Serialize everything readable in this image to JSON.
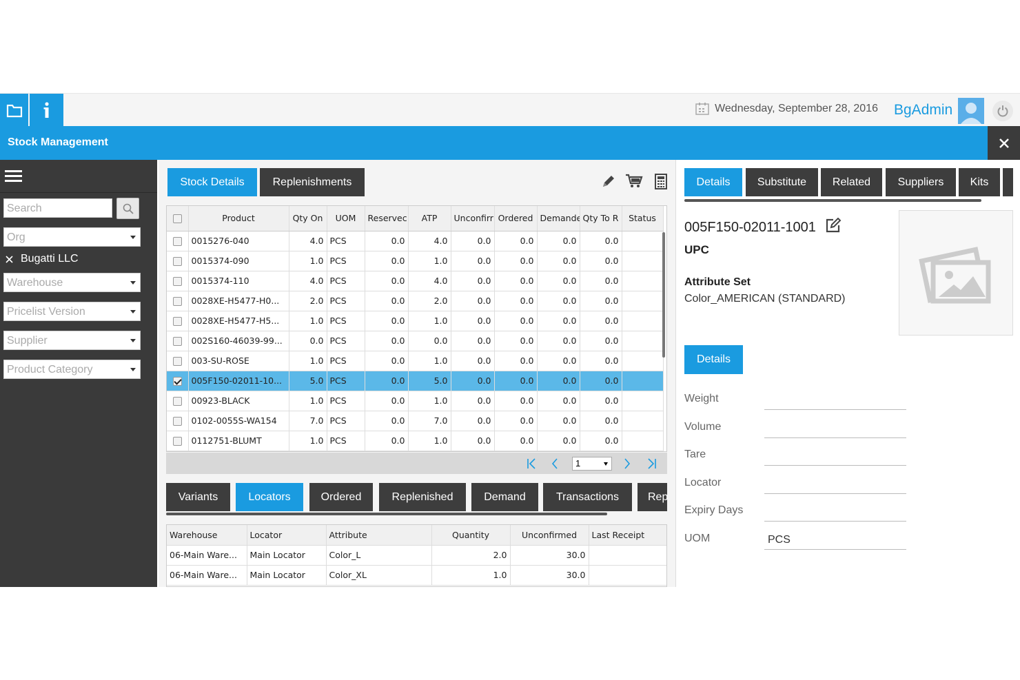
{
  "topbar": {
    "date": "Wednesday, September 28, 2016",
    "user": "BgAdmin"
  },
  "title": "Stock Management",
  "sidebar": {
    "search_placeholder": "Search",
    "org_placeholder": "Org",
    "org_selected": "Bugatti LLC",
    "warehouse_placeholder": "Warehouse",
    "pricelist_placeholder": "Pricelist Version",
    "supplier_placeholder": "Supplier",
    "category_placeholder": "Product Category"
  },
  "center_tabs": [
    "Stock Details",
    "Replenishments"
  ],
  "grid": {
    "columns": [
      "Product",
      "Qty On",
      "UOM",
      "Reservec",
      "ATP",
      "Unconfirr",
      "Ordered",
      "Demande",
      "Qty To R",
      "Status"
    ],
    "rows": [
      {
        "product": "0015276-040",
        "qty": "4.0",
        "uom": "PCS",
        "reserved": "0.0",
        "atp": "4.0",
        "unconfirmed": "0.0",
        "ordered": "0.0",
        "demand": "0.0",
        "qty_to_r": "0.0",
        "status": "",
        "checked": false
      },
      {
        "product": "0015374-090",
        "qty": "1.0",
        "uom": "PCS",
        "reserved": "0.0",
        "atp": "1.0",
        "unconfirmed": "0.0",
        "ordered": "0.0",
        "demand": "0.0",
        "qty_to_r": "0.0",
        "status": "",
        "checked": false
      },
      {
        "product": "0015374-110",
        "qty": "4.0",
        "uom": "PCS",
        "reserved": "0.0",
        "atp": "4.0",
        "unconfirmed": "0.0",
        "ordered": "0.0",
        "demand": "0.0",
        "qty_to_r": "0.0",
        "status": "",
        "checked": false
      },
      {
        "product": "0028XE-H5477-H0...",
        "qty": "2.0",
        "uom": "PCS",
        "reserved": "0.0",
        "atp": "2.0",
        "unconfirmed": "0.0",
        "ordered": "0.0",
        "demand": "0.0",
        "qty_to_r": "0.0",
        "status": "",
        "checked": false
      },
      {
        "product": "0028XE-H5477-H5...",
        "qty": "1.0",
        "uom": "PCS",
        "reserved": "0.0",
        "atp": "1.0",
        "unconfirmed": "0.0",
        "ordered": "0.0",
        "demand": "0.0",
        "qty_to_r": "0.0",
        "status": "",
        "checked": false
      },
      {
        "product": "002S160-46039-99...",
        "qty": "0.0",
        "uom": "PCS",
        "reserved": "0.0",
        "atp": "0.0",
        "unconfirmed": "0.0",
        "ordered": "0.0",
        "demand": "0.0",
        "qty_to_r": "0.0",
        "status": "",
        "checked": false
      },
      {
        "product": "003-SU-ROSE",
        "qty": "1.0",
        "uom": "PCS",
        "reserved": "0.0",
        "atp": "1.0",
        "unconfirmed": "0.0",
        "ordered": "0.0",
        "demand": "0.0",
        "qty_to_r": "0.0",
        "status": "",
        "checked": false
      },
      {
        "product": "005F150-02011-10...",
        "qty": "5.0",
        "uom": "PCS",
        "reserved": "0.0",
        "atp": "5.0",
        "unconfirmed": "0.0",
        "ordered": "0.0",
        "demand": "0.0",
        "qty_to_r": "0.0",
        "status": "",
        "checked": true
      },
      {
        "product": "00923-BLACK",
        "qty": "1.0",
        "uom": "PCS",
        "reserved": "0.0",
        "atp": "1.0",
        "unconfirmed": "0.0",
        "ordered": "0.0",
        "demand": "0.0",
        "qty_to_r": "0.0",
        "status": "",
        "checked": false
      },
      {
        "product": "0102-0055S-WA154",
        "qty": "7.0",
        "uom": "PCS",
        "reserved": "0.0",
        "atp": "7.0",
        "unconfirmed": "0.0",
        "ordered": "0.0",
        "demand": "0.0",
        "qty_to_r": "0.0",
        "status": "",
        "checked": false
      },
      {
        "product": "0112751-BLUMT",
        "qty": "1.0",
        "uom": "PCS",
        "reserved": "0.0",
        "atp": "1.0",
        "unconfirmed": "0.0",
        "ordered": "0.0",
        "demand": "0.0",
        "qty_to_r": "0.0",
        "status": "",
        "checked": false
      }
    ]
  },
  "pager": {
    "page": "1"
  },
  "bottom_tabs": [
    "Variants",
    "Locators",
    "Ordered",
    "Replenished",
    "Demand",
    "Transactions",
    "Rep"
  ],
  "subgrid": {
    "columns": [
      "Warehouse",
      "Locator",
      "Attribute",
      "Quantity",
      "Unconfirmed",
      "Last Receipt"
    ],
    "rows": [
      {
        "warehouse": "06-Main Ware...",
        "locator": "Main Locator",
        "attribute": "Color_L",
        "quantity": "2.0",
        "unconfirmed": "30.0",
        "last_receipt": ""
      },
      {
        "warehouse": "06-Main Ware...",
        "locator": "Main Locator",
        "attribute": "Color_XL",
        "quantity": "1.0",
        "unconfirmed": "30.0",
        "last_receipt": ""
      }
    ]
  },
  "right_tabs": [
    "Details",
    "Substitute",
    "Related",
    "Suppliers",
    "Kits"
  ],
  "detail": {
    "product_code": "005F150-02011-1001",
    "upc_label": "UPC",
    "attribute_set_label": "Attribute Set",
    "attribute_set_value": "Color_AMERICAN (STANDARD)",
    "details_button": "Details",
    "fields": [
      {
        "label": "Weight",
        "value": ""
      },
      {
        "label": "Volume",
        "value": ""
      },
      {
        "label": "Tare",
        "value": ""
      },
      {
        "label": "Locator",
        "value": ""
      },
      {
        "label": "Expiry Days",
        "value": ""
      },
      {
        "label": "UOM",
        "value": "PCS"
      }
    ]
  },
  "colors": {
    "accent": "#1a9be0",
    "dark": "#3a3a3a",
    "selected_row": "#5bb8e8"
  }
}
